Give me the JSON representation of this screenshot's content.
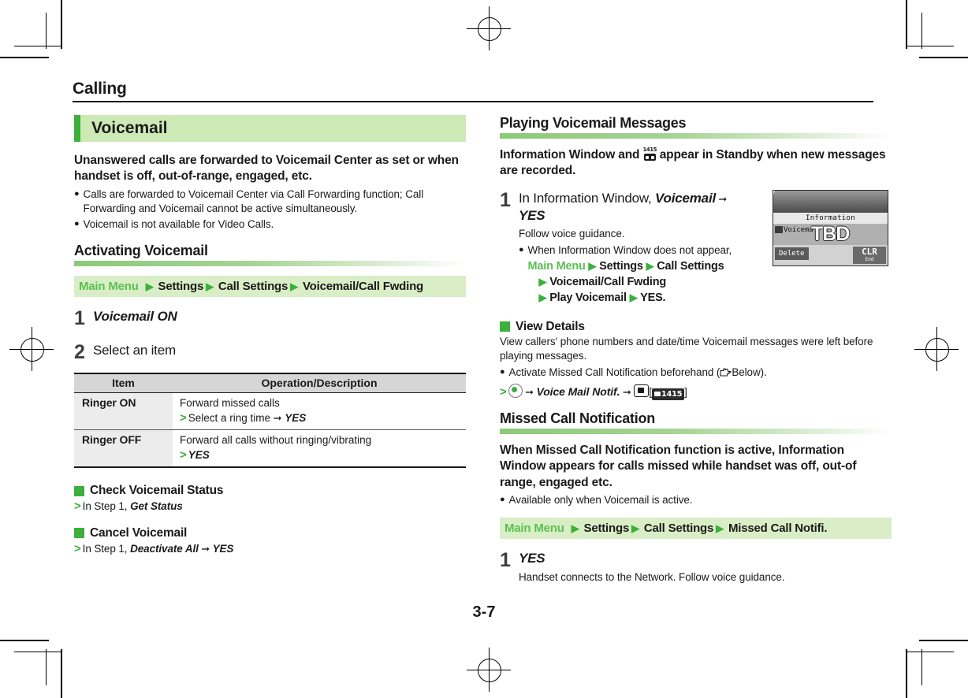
{
  "page": {
    "chapter": "Calling",
    "number": "3-7"
  },
  "left": {
    "banner": "Voicemail",
    "lead": "Unanswered calls are forwarded to Voicemail Center as set or when handset is off, out-of-range, engaged, etc.",
    "notes": [
      "Calls are forwarded to Voicemail Center via Call Forwarding function; Call Forwarding and Voicemail cannot be active simultaneously.",
      "Voicemail is not available for Video Calls."
    ],
    "subhead": "Activating Voicemail",
    "menupath": {
      "root": "Main Menu",
      "segments": [
        "Settings",
        "Call Settings",
        "Voicemail/Call Fwding"
      ]
    },
    "step1": {
      "num": "1",
      "title": "Voicemail ON"
    },
    "step2": {
      "num": "2",
      "title": "Select an item"
    },
    "table": {
      "headers": [
        "Item",
        "Operation/Description"
      ],
      "rows": [
        {
          "item": "Ringer ON",
          "desc_line1": "Forward missed calls",
          "desc_line2_pre": "Select a ring time",
          "desc_line2_post": "YES"
        },
        {
          "item": "Ringer OFF",
          "desc_line1": "Forward all calls without ringing/vibrating",
          "desc_line2_pre": "",
          "desc_line2_post": "YES"
        }
      ]
    },
    "blocks": [
      {
        "heading": "Check Voicemail Status",
        "line_pre": "In Step 1, ",
        "line_em": "Get Status",
        "line_post": ""
      },
      {
        "heading": "Cancel Voicemail",
        "line_pre": "In Step 1, ",
        "line_em": "Deactivate All",
        "line_post": "YES"
      }
    ]
  },
  "right": {
    "subhead_playing": "Playing Voicemail Messages",
    "lead_pre": "Information Window and ",
    "lead_post": " appear in Standby when new messages are recorded.",
    "voicemail_icon_time": "1415",
    "step1": {
      "num": "1",
      "title_pre": "In Information Window, ",
      "title_em": "Voicemail",
      "title_post": "YES",
      "sub": "Follow voice guidance.",
      "note_line1": "When Information Window does not appear,",
      "note_menu_root": "Main Menu",
      "note_menu_segs": [
        "Settings",
        "Call Settings",
        "Voicemail/Call Fwding",
        "Play Voicemail",
        "YES"
      ]
    },
    "phone": {
      "titlebar": "Information",
      "list_item": "Voicema",
      "overlay": "TBD",
      "soft_left": "Delete",
      "soft_right_big": "CLR",
      "soft_right_small": "End"
    },
    "view_details": {
      "heading": "View Details",
      "body": "View callers' phone numbers and date/time Voicemail messages were left before playing messages.",
      "note_pre": "Activate Missed Call Notification beforehand (",
      "note_post": "Below).",
      "op_em": "Voice Mail Notif.",
      "op_chip": "1415"
    },
    "missed": {
      "subhead": "Missed Call Notification",
      "lead": "When Missed Call Notification function is active, Information Window appears for calls missed while handset was off, out-of range, engaged etc.",
      "note": "Available only when Voicemail is active.",
      "menupath": {
        "root": "Main Menu",
        "segments": [
          "Settings",
          "Call Settings",
          "Missed Call Notifi."
        ]
      },
      "step1": {
        "num": "1",
        "title": "YES",
        "sub": "Handset connects to the Network. Follow voice guidance."
      }
    }
  },
  "colors": {
    "accent_green": "#3bb03b",
    "banner_bg": "#cde9b6",
    "menupath_bg": "#d9eec6",
    "menu_root_green": "#5cbf53",
    "table_header_bg": "#d6d6d6",
    "table_item_bg": "#ececec"
  }
}
